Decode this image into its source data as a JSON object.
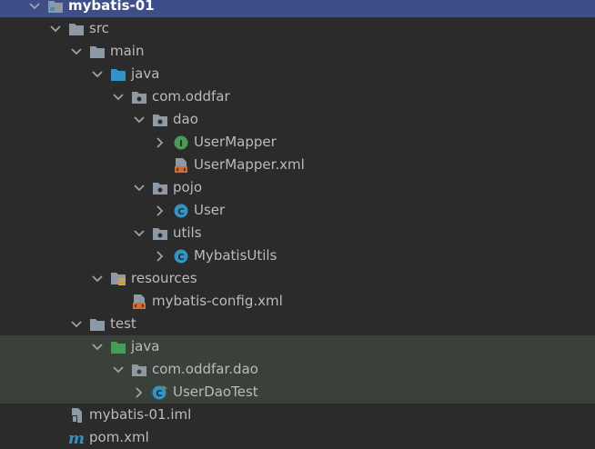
{
  "tree": {
    "project": "mybatis-01",
    "src": "src",
    "main": "main",
    "main_java": "java",
    "pkg_com_oddfar": "com.oddfar",
    "pkg_dao": "dao",
    "user_mapper": "UserMapper",
    "user_mapper_xml": "UserMapper.xml",
    "pkg_pojo": "pojo",
    "user_class": "User",
    "pkg_utils": "utils",
    "mybatis_utils": "MybatisUtils",
    "resources": "resources",
    "mybatis_config": "mybatis-config.xml",
    "test": "test",
    "test_java": "java",
    "pkg_com_oddfar_dao": "com.oddfar.dao",
    "user_dao_test": "UserDaoTest",
    "iml_file": "mybatis-01.iml",
    "pom_file": "pom.xml"
  },
  "icons": {
    "interface_letter": "I",
    "class_letter": "C",
    "maven_letter": "m"
  },
  "colors": {
    "background": "#2b2b2b",
    "selection": "#3d4f86",
    "test_highlight": "#39413a",
    "folder": "#8d9aa5",
    "source_folder": "#3592c4",
    "test_folder": "#499c54",
    "interface": "#499c54",
    "class": "#3592c4",
    "xml": "#d66a32"
  }
}
